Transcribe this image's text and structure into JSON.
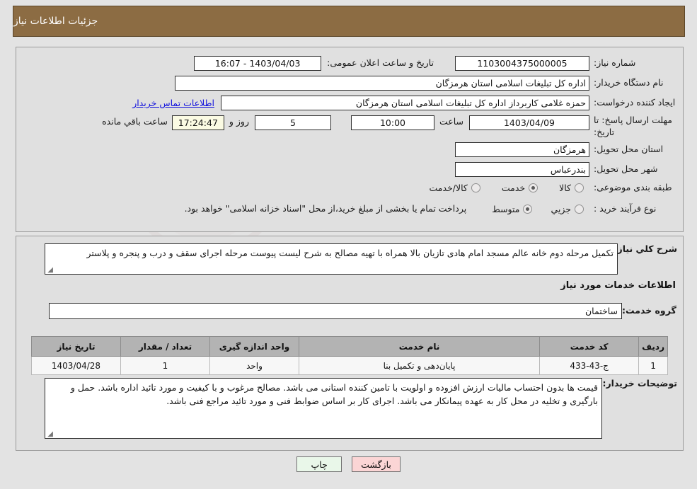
{
  "header": {
    "title": "جزئیات اطلاعات نیاز"
  },
  "watermark": {
    "text": "AriaTender.net"
  },
  "form": {
    "need_number_label": "شماره نیاز:",
    "need_number_value": "1103004375000005",
    "public_announce_label": "تاریخ و ساعت اعلان عمومی:",
    "public_announce_value": "1403/04/03 - 16:07",
    "buyer_org_label": "نام دستگاه خریدار:",
    "buyer_org_value": "اداره کل تبلیغات اسلامی استان هرمزگان",
    "requester_label": "ایجاد کننده درخواست:",
    "requester_value": "حمزه غلامی کاربرداز اداره کل تبلیغات اسلامی استان هرمزگان",
    "contact_link": "اطلاعات تماس خریدار",
    "deadline_label": "مهلت ارسال پاسخ: تا تاریخ:",
    "deadline_date": "1403/04/09",
    "deadline_hour_label": "ساعت",
    "deadline_hour_value": "10:00",
    "remaining_days": "5",
    "remaining_days_label": "روز و",
    "remaining_time": "17:24:47",
    "remaining_suffix": "ساعت باقي مانده",
    "province_label": "استان محل تحویل:",
    "province_value": "هرمزگان",
    "city_label": "شهر محل تحویل:",
    "city_value": "بندرعباس",
    "category_label": "طبقه بندی موضوعی:",
    "category_options": [
      {
        "label": "کالا",
        "selected": false
      },
      {
        "label": "خدمت",
        "selected": true
      },
      {
        "label": "کالا/خدمت",
        "selected": false
      }
    ],
    "process_label": "نوع فرآیند خرید :",
    "process_options": [
      {
        "label": "جزيي",
        "selected": false
      },
      {
        "label": "متوسط",
        "selected": true
      }
    ],
    "treasury_note": "پرداخت تمام یا بخشی از مبلغ خرید،از محل \"اسناد خزانه اسلامی\" خواهد بود."
  },
  "description": {
    "label": "شرح کلي نیاز:",
    "value": "تکمیل مرحله دوم خانه عالم مسجد امام هادی تازیان بالا همراه با تهیه مصالح به شرح لیست پیوست مرحله اجرای سقف و درب و پنجره و پلاستر"
  },
  "services": {
    "section_title": "اطلاعات خدمات مورد نیاز",
    "group_label": "گروه خدمت:",
    "group_value": "ساختمان",
    "columns": [
      "ردیف",
      "کد خدمت",
      "نام خدمت",
      "واحد اندازه گیری",
      "تعداد / مقدار",
      "تاریخ نیاز"
    ],
    "rows": [
      {
        "index": "1",
        "code": "ج-43-433",
        "name": "پایان‌دهی و تکمیل بنا",
        "unit": "واحد",
        "qty": "1",
        "date": "1403/04/28"
      }
    ]
  },
  "buyer_notes": {
    "label": "توضیحات خریدار:",
    "value": "قیمت ها بدون احتساب مالیات ارزش افزوده و اولویت با تامین کننده استانی می باشد. مصالح مرغوب و با کیفیت و مورد تائید اداره باشد.  حمل و بارگیری و تخلیه در محل کار به عهده پیمانکار می باشد.      اجرای کار بر اساس ضوابط فنی و مورد تائید مراجع فنی باشد."
  },
  "buttons": {
    "print": "چاپ",
    "back": "بازگشت"
  },
  "colors": {
    "header_bg": "#8c6c43",
    "panel_bg": "#e0e0e0",
    "page_bg": "#e3e3e3",
    "link": "#1111dd",
    "table_header_bg": "#b3b3b3",
    "print_btn_bg": "#e9f7e9",
    "back_btn_bg": "#fbd5d5"
  }
}
